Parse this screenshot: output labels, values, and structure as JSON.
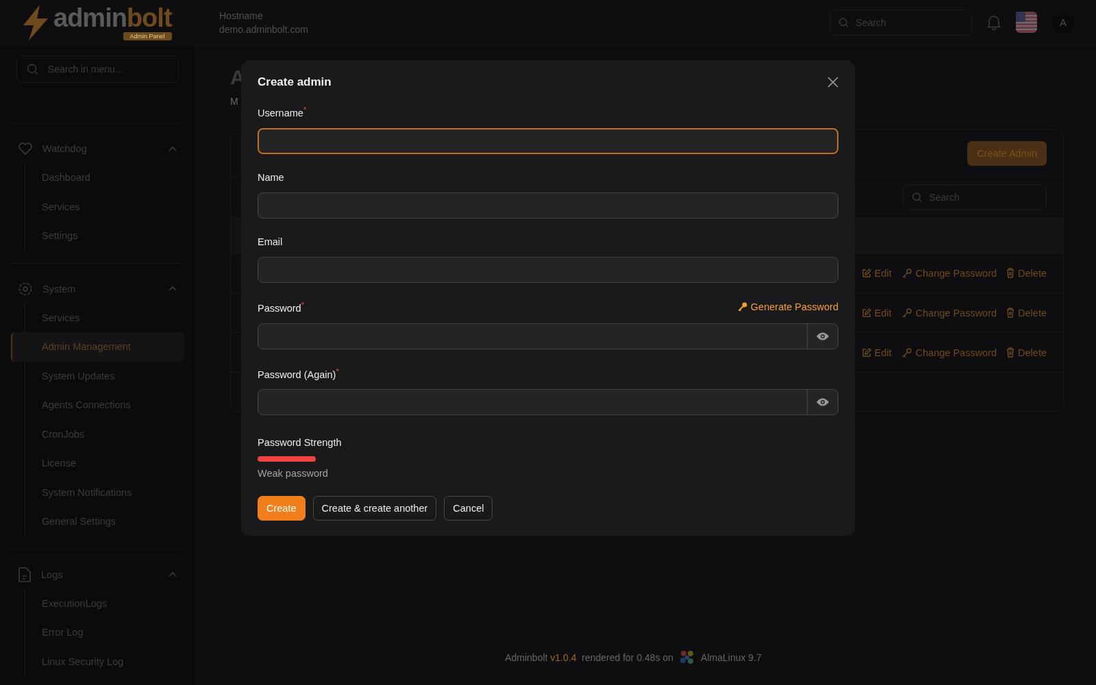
{
  "header": {
    "logo": {
      "first": "admin",
      "second": "bolt",
      "badge": "Admin Panel"
    },
    "hostname_label": "Hostname",
    "hostname": "demo.adminbolt.com",
    "search": {
      "placeholder": "Search"
    },
    "avatar": "A"
  },
  "sidebar": {
    "search": {
      "placeholder": "Search in menu..."
    },
    "groups": [
      {
        "label": "Watchdog",
        "expanded": true,
        "items": [
          {
            "label": "Dashboard",
            "selected": false
          },
          {
            "label": "Services",
            "selected": false
          },
          {
            "label": "Settings",
            "selected": false
          }
        ]
      },
      {
        "label": "System",
        "expanded": true,
        "items": [
          {
            "label": "Services",
            "selected": false
          },
          {
            "label": "Admin Management",
            "selected": true
          },
          {
            "label": "System Updates",
            "selected": false
          },
          {
            "label": "Agents Connections",
            "selected": false
          },
          {
            "label": "CronJobs",
            "selected": false
          },
          {
            "label": "License",
            "selected": false
          },
          {
            "label": "System Notifications",
            "selected": false
          },
          {
            "label": "General Settings",
            "selected": false
          }
        ]
      },
      {
        "label": "Logs",
        "expanded": true,
        "items": [
          {
            "label": "ExecutionLogs",
            "selected": false
          },
          {
            "label": "Error Log",
            "selected": false
          },
          {
            "label": "Linux Security Log",
            "selected": false
          }
        ]
      }
    ]
  },
  "page": {
    "title": "A",
    "subtitle": "M",
    "create_button": "Create Admin",
    "search": {
      "placeholder": "Search"
    },
    "rows": [
      {
        "actions": [
          "Edit",
          "Change Password",
          "Delete"
        ]
      },
      {
        "actions": [
          "Edit",
          "Change Password",
          "Delete"
        ]
      },
      {
        "actions": [
          "Edit",
          "Change Password",
          "Delete"
        ]
      }
    ]
  },
  "footer": {
    "product": "Adminbolt",
    "version": "v1.0.4",
    "rendered": "rendered for 0.48s on",
    "os": "AlmaLinux 9.7"
  },
  "modal": {
    "title": "Create admin",
    "fields": [
      {
        "label": "Username",
        "kind": "text",
        "required_mark": "*",
        "focused": true
      },
      {
        "label": "Name",
        "kind": "text",
        "focused": false
      },
      {
        "label": "Email",
        "kind": "text",
        "focused": false
      },
      {
        "label": "Password",
        "kind": "password",
        "required_mark": "*",
        "focused": false,
        "action": "Generate Password"
      },
      {
        "label": "Password (Again)",
        "kind": "password",
        "required_mark": "*",
        "focused": false
      }
    ],
    "strength": {
      "label": "Password Strength",
      "level": 0.1,
      "reading": "Weak password"
    },
    "buttons": [
      {
        "label": "Create",
        "primary": true
      },
      {
        "label": "Create & create another",
        "primary": false
      },
      {
        "label": "Cancel",
        "primary": false
      }
    ]
  }
}
